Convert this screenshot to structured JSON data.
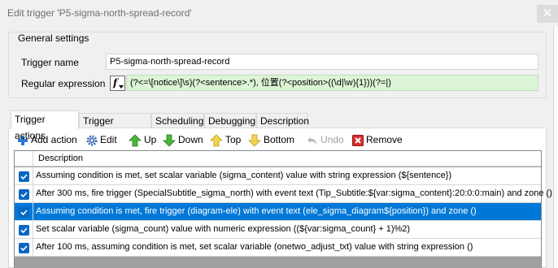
{
  "window": {
    "title": "Edit trigger 'P5-sigma-north-spread-record'",
    "close_glyph": "✕"
  },
  "general": {
    "legend": "General settings",
    "trigger_name_label": "Trigger name",
    "trigger_name_value": "P5-sigma-north-spread-record",
    "regex_label": "Regular expression",
    "regex_value": "(?<=\\[notice\\]\\s)(?<sentence>.*), 位置(?<position>((\\d|\\w){1}))(?=|)",
    "regex_button_glyph": "f"
  },
  "tabs": [
    {
      "label": "Trigger actions",
      "active": true
    },
    {
      "label": "Trigger condition",
      "active": false
    },
    {
      "label": "Scheduling",
      "active": false
    },
    {
      "label": "Debugging",
      "active": false
    },
    {
      "label": "Description",
      "active": false
    }
  ],
  "toolbar": {
    "add": "Add action",
    "edit": "Edit",
    "up": "Up",
    "down": "Down",
    "top": "Top",
    "bottom": "Bottom",
    "undo": "Undo",
    "remove": "Remove"
  },
  "grid": {
    "column_header": "Description",
    "rows": [
      {
        "checked": true,
        "selected": false,
        "text": "Assuming condition is met, set scalar variable (sigma_content) value with string expression (${sentence})"
      },
      {
        "checked": true,
        "selected": false,
        "text": "After 300 ms, fire trigger (SpecialSubtitle_sigma_north) with event text (Tip_Subtitle:${var:sigma_content}:20:0:0:main) and zone ()"
      },
      {
        "checked": true,
        "selected": true,
        "text": "Assuming condition is met, fire trigger (diagram-ele) with event text (ele_sigma_diagram${position}) and zone ()"
      },
      {
        "checked": true,
        "selected": false,
        "text": "Set scalar variable (sigma_count) value with numeric expression ((${var:sigma_count} + 1)%2)"
      },
      {
        "checked": true,
        "selected": false,
        "text": "After 100 ms, assuming condition is met, set scalar variable (onetwo_adjust_txt) value with string expression ()"
      }
    ]
  },
  "colors": {
    "selection": "#0078d7",
    "regex_background": "#ddf5d6",
    "checkbox": "#0a66c2"
  }
}
